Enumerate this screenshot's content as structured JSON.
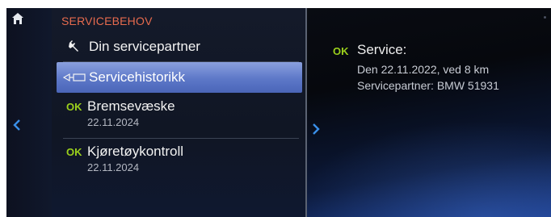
{
  "menu": {
    "header": "SERVICEBEHOV",
    "items": [
      {
        "label": "Din servicepartner",
        "icon": "wrench-icon"
      },
      {
        "label": "Servicehistorikk",
        "icon": "service-history-icon",
        "selected": true
      },
      {
        "status": "OK",
        "label": "Bremsevæske",
        "date": "22.11.2024"
      },
      {
        "status": "OK",
        "label": "Kjøretøykontroll",
        "date": "22.11.2024"
      }
    ]
  },
  "detail": {
    "status": "OK",
    "title": "Service:",
    "line1": "Den 22.11.2022, ved 8 km",
    "line2": "Servicepartner: BMW 51931"
  },
  "colors": {
    "header_accent": "#e76b4e",
    "ok_green": "#9bd01c",
    "selection_blue": "#5d78c8",
    "arrow_blue": "#3a8fe8"
  },
  "icons": [
    "home-icon",
    "chevron-left-icon",
    "chevron-right-icon",
    "wrench-icon",
    "service-history-icon"
  ]
}
